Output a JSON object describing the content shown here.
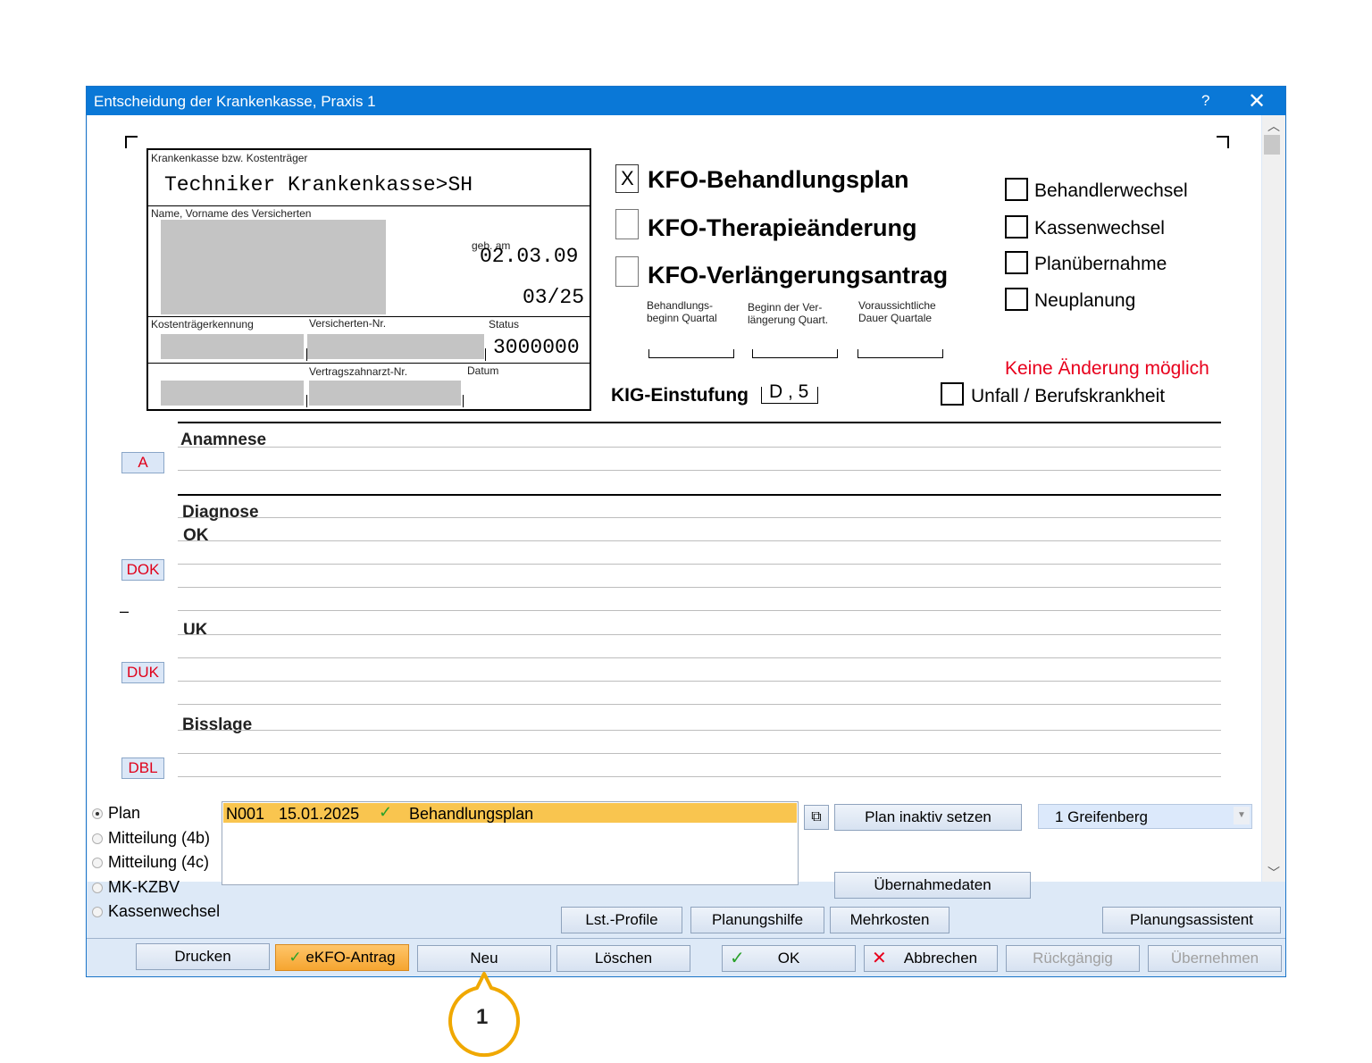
{
  "window": {
    "title": "Entscheidung der Krankenkasse, Praxis 1",
    "help": "?",
    "close": "✕"
  },
  "card": {
    "insurer_label": "Krankenkasse bzw. Kostenträger",
    "insurer_value": "Techniker Krankenkasse>SH",
    "name_label": "Name, Vorname des Versicherten",
    "dob_label": "geb. am",
    "dob_value": "02.03.09",
    "valid_value": "03/25",
    "cost_id_label": "Kostenträgerkennung",
    "insured_no_label": "Versicherten-Nr.",
    "status_label": "Status",
    "status_value": "3000000",
    "dentist_no_label": "Vertragszahnarzt-Nr.",
    "date_label": "Datum"
  },
  "plan_types": [
    {
      "label": "KFO-Behandlungsplan",
      "mark": "X"
    },
    {
      "label": "KFO-Therapieänderung",
      "mark": ""
    },
    {
      "label": "KFO-Verlängerungsantrag",
      "mark": ""
    }
  ],
  "quarters": {
    "begin_label": [
      "Behandlungs-",
      "beginn Quartal"
    ],
    "ext_label": [
      "Beginn der Ver-",
      "längerung Quart."
    ],
    "dur_label": [
      "Voraussichtliche",
      "Dauer Quartale"
    ]
  },
  "options": [
    {
      "label": "Behandlerwechsel"
    },
    {
      "label": "Kassenwechsel"
    },
    {
      "label": "Planübernahme"
    },
    {
      "label": "Neuplanung"
    }
  ],
  "warning": "Keine Änderung möglich",
  "accident_label": "Unfall / Berufskrankheit",
  "kig": {
    "label": "KIG-Einstufung",
    "value": "D , 5"
  },
  "sections": {
    "anamnese": "Anamnese",
    "diagnose": "Diagnose",
    "ok": "OK",
    "uk": "UK",
    "bisslage": "Bisslage"
  },
  "codes": {
    "a": "A",
    "dok": "DOK",
    "duk": "DUK",
    "dbl": "DBL",
    "dash": "–"
  },
  "radios": [
    {
      "label": "Plan",
      "selected": true
    },
    {
      "label": "Mitteilung (4b)",
      "selected": false
    },
    {
      "label": "Mitteilung (4c)",
      "selected": false
    },
    {
      "label": "MK-KZBV",
      "selected": false
    },
    {
      "label": "Kassenwechsel",
      "selected": false
    }
  ],
  "plan_list": [
    {
      "id": "N001",
      "date": "15.01.2025",
      "check": "✓",
      "name": "Behandlungsplan"
    }
  ],
  "buttons": {
    "plan_inactive": "Plan inaktiv setzen",
    "location": "1 Greifenberg",
    "takeover_data": "Übernahmedaten",
    "lst_profiles": "Lst.-Profile",
    "planning_help": "Planungshilfe",
    "extra_costs": "Mehrkosten",
    "planning_assistant": "Planungsassistent",
    "print": "Drucken",
    "ekfo": "eKFO-Antrag",
    "new": "Neu",
    "delete": "Löschen",
    "ok": "OK",
    "cancel": "Abbrechen",
    "undo": "Rückgängig",
    "apply": "Übernehmen"
  },
  "callout": {
    "number": "1"
  },
  "colors": {
    "title_bar": "#0a78d7",
    "highlight_row": "#f9c54f",
    "warning": "#e8001c",
    "callout": "#f0a800"
  }
}
